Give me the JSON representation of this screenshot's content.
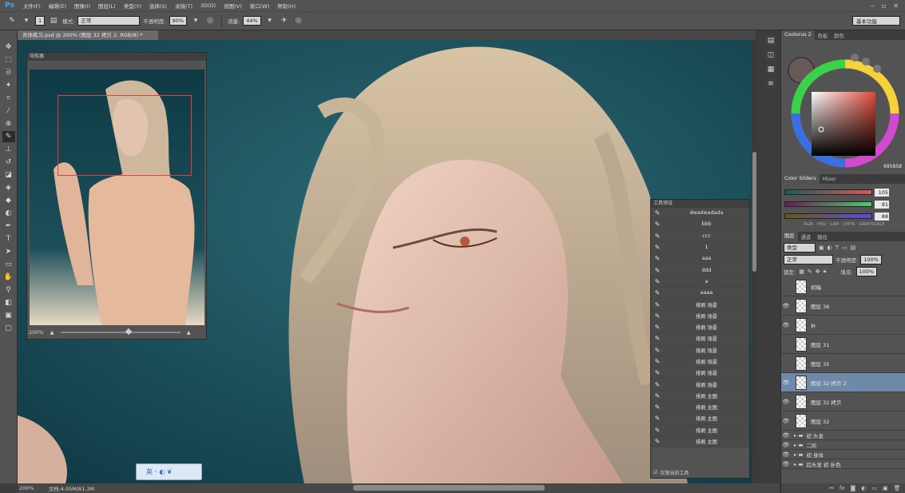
{
  "app": {
    "logo": "Ps",
    "workspace": "基本功能"
  },
  "menu": [
    "文件(F)",
    "编辑(E)",
    "图像(I)",
    "图层(L)",
    "类型(Y)",
    "选择(S)",
    "滤镜(T)",
    "3D(D)",
    "视图(V)",
    "窗口(W)",
    "帮助(H)"
  ],
  "window_controls": [
    "‒",
    "▫",
    "✕"
  ],
  "options": {
    "size": "1",
    "mode_label": "模式:",
    "mode_value": "正常",
    "opacity_label": "不透明度:",
    "opacity_value": "90%",
    "flow_label": "流量:",
    "flow_value": "44%"
  },
  "document": {
    "tab_title": "灵体练习.psd @ 200% (图层 32 拷贝 2, RGB/8) *",
    "zoom": "200%",
    "doc_size": "文档:4.05M/81.3M"
  },
  "navigator": {
    "title": "导航器",
    "zoom": "200%"
  },
  "tool_presets": {
    "title": "工具预设",
    "items": [
      "dwadwadada",
      "bbb",
      "ccc",
      "1",
      "aaa",
      "ddd",
      "a",
      "aaaa",
      "排刷 场景",
      "排刷 场景",
      "排刷 场景",
      "排刷 场景",
      "排刷 场景",
      "排刷 场景",
      "排刷 场景",
      "排刷 场景",
      "排刷 主图",
      "排刷 主图",
      "排刷 主图",
      "排刷 主图",
      "排刷 主图"
    ],
    "footer_label": "仅限当前工具"
  },
  "coolorus": {
    "tabs": [
      "Coolorus 2",
      "色板",
      "颜色"
    ],
    "hex": "695858"
  },
  "sliders": {
    "tabs": [
      "Color Sliders",
      "Mixer"
    ],
    "r": "105",
    "g": "91",
    "b": "88",
    "modes": [
      "RGB",
      "HSV",
      "LAB",
      "CMYK",
      "GRAYSCALE"
    ]
  },
  "layers": {
    "tabs": [
      "图层",
      "通道",
      "路径"
    ],
    "filter": "类型",
    "blend": "正常",
    "opacity_label": "不透明度:",
    "opacity": "100%",
    "lock_label": "锁定:",
    "fill_label": "填充:",
    "fill": "100%",
    "items": [
      {
        "name": "初稿",
        "visible": false
      },
      {
        "name": "图层 36",
        "visible": true
      },
      {
        "name": "补",
        "visible": true
      },
      {
        "name": "图层 31",
        "visible": false
      },
      {
        "name": "图层 35",
        "visible": false
      },
      {
        "name": "图层 32 拷贝 2",
        "visible": true,
        "selected": true
      },
      {
        "name": "图层 32 拷贝",
        "visible": true
      },
      {
        "name": "图层 32",
        "visible": true
      }
    ],
    "groups": [
      "初 头发",
      "二阶",
      "初 身体",
      "后头发 初 补色"
    ]
  },
  "ime_bar": "英 ᵕ ◐ ❦"
}
